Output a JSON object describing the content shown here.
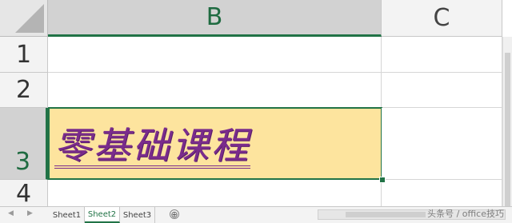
{
  "columns": [
    {
      "label": "B",
      "selected": true
    },
    {
      "label": "C",
      "selected": false
    }
  ],
  "rows": [
    {
      "label": "1",
      "selected": false
    },
    {
      "label": "2",
      "selected": false
    },
    {
      "label": "3",
      "selected": true
    },
    {
      "label": "4",
      "selected": false
    }
  ],
  "cells": {
    "B3": {
      "value": "零基础课程",
      "fill_color": "#fde49e",
      "font_color": "#7a2c8c",
      "italic": true,
      "underline": "double"
    }
  },
  "sheet_tabs": [
    {
      "label": "Sheet1",
      "active": false
    },
    {
      "label": "Sheet2",
      "active": true
    },
    {
      "label": "Sheet3",
      "active": false
    }
  ],
  "add_sheet_symbol": "⊕",
  "nav_arrows": [
    "◀",
    "▶"
  ],
  "watermark": "头条号 / office技巧",
  "accent_color": "#217346"
}
